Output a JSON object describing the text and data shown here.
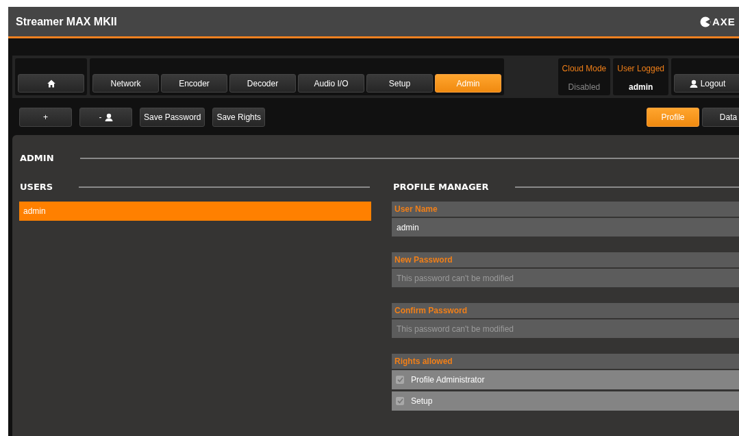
{
  "header": {
    "title": "Streamer MAX MKII",
    "logo_text": "AXE"
  },
  "nav": {
    "tabs": [
      {
        "label": "Network",
        "selected": false
      },
      {
        "label": "Encoder",
        "selected": false
      },
      {
        "label": "Decoder",
        "selected": false
      },
      {
        "label": "Audio I/O",
        "selected": false
      },
      {
        "label": "Setup",
        "selected": false
      },
      {
        "label": "Admin",
        "selected": true
      }
    ],
    "status": [
      {
        "label": "Cloud Mode",
        "value": "Disabled",
        "disabled": true
      },
      {
        "label": "User Logged",
        "value": "admin",
        "disabled": false
      }
    ],
    "logout": "Logout"
  },
  "toolbar": {
    "actions": [
      {
        "kind": "add",
        "label": "+"
      },
      {
        "kind": "remove-user",
        "label": "-"
      },
      {
        "kind": "text",
        "label": "Save Password"
      },
      {
        "kind": "text",
        "label": "Save Rights"
      }
    ],
    "views": [
      {
        "label": "Profile",
        "selected": true
      },
      {
        "label": "Data",
        "selected": false
      }
    ]
  },
  "panel": {
    "title": "ADMIN",
    "users": {
      "title": "USERS",
      "items": [
        {
          "name": "admin",
          "selected": true
        }
      ]
    },
    "profile": {
      "title": "PROFILE MANAGER",
      "fields": [
        {
          "label": "User Name",
          "value": "admin"
        },
        {
          "label": "New Password",
          "placeholder": "This password can't be modified"
        },
        {
          "label": "Confirm Password",
          "placeholder": "This password can't be modified"
        }
      ],
      "rights_title": "Rights allowed",
      "rights": [
        {
          "label": "Profile Administrator",
          "checked": true,
          "disabled": true
        },
        {
          "label": "Setup",
          "checked": true,
          "disabled": true
        }
      ]
    }
  }
}
